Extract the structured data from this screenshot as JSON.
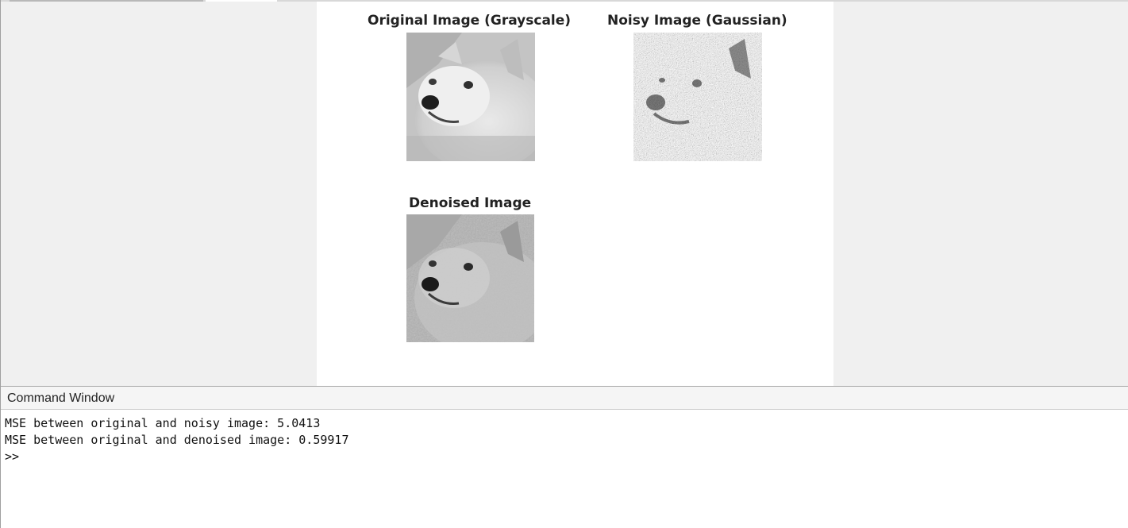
{
  "figure": {
    "subplots": [
      {
        "title": "Original Image (Grayscale)",
        "image": "doge-grayscale-original"
      },
      {
        "title": "Noisy Image (Gaussian)",
        "image": "doge-gaussian-noisy"
      },
      {
        "title": "Denoised Image",
        "image": "doge-denoised"
      }
    ]
  },
  "command_window": {
    "title": "Command Window",
    "lines": [
      "MSE between original and noisy image: 5.0413",
      "MSE between original and denoised image: 0.59917"
    ],
    "prompt": ">>"
  }
}
